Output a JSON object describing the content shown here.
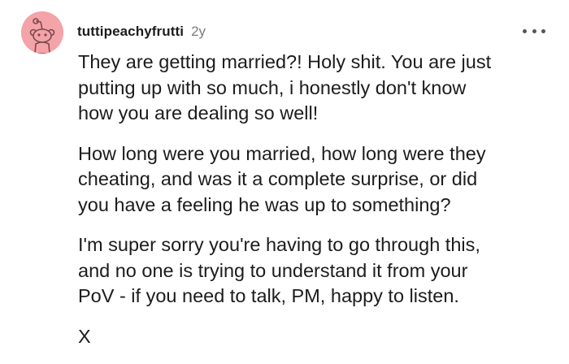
{
  "comment": {
    "username": "tuttipeachyfrutti",
    "age": "2y",
    "avatar_color": "#f4a3a8",
    "more_icon": "more-horizontal-icon",
    "paragraphs": [
      {
        "lines": [
          "They are getting married?! Holy shit. You are just",
          "putting up with so much, i honestly don't know",
          "how you are dealing so well!"
        ]
      },
      {
        "lines": [
          "How long were you married, how long were they",
          "cheating, and was it a complete surprise, or did",
          "you have a feeling he was up to something?"
        ]
      },
      {
        "lines": [
          "I'm super sorry you're having to go through this,",
          "and no one is trying to understand it from your",
          "PoV - if you need to talk, PM, happy to listen."
        ]
      },
      {
        "lines": [
          "X"
        ]
      }
    ]
  }
}
